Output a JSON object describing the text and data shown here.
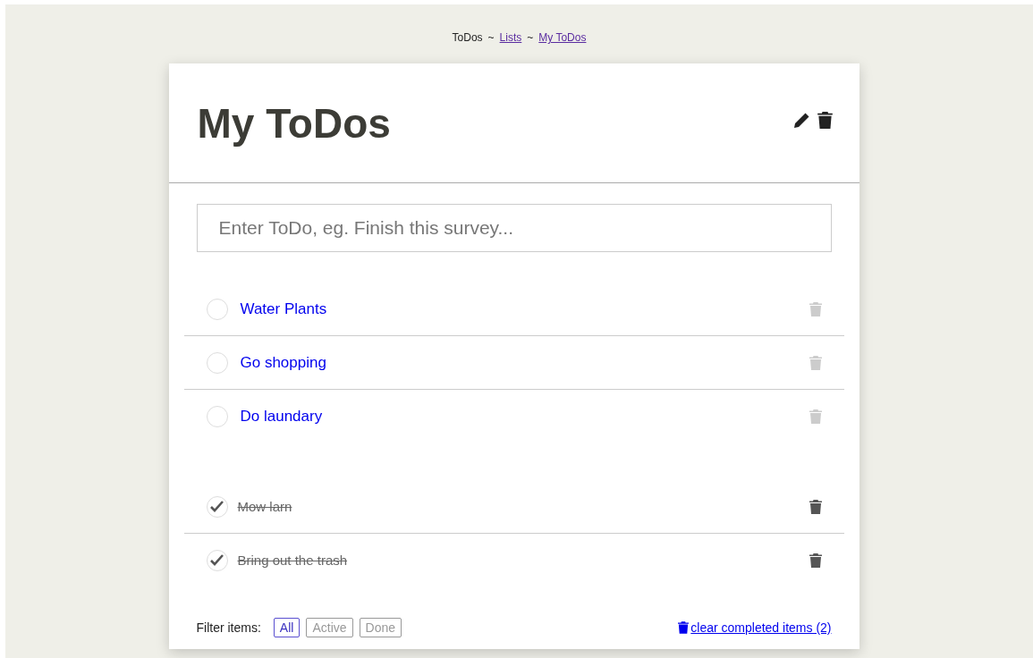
{
  "breadcrumb": [
    {
      "label": "ToDos",
      "link": false
    },
    {
      "label": "Lists",
      "link": true
    },
    {
      "label": "My ToDos",
      "link": true
    }
  ],
  "separator": "~",
  "title": "My ToDos",
  "input": {
    "placeholder": "Enter ToDo, eg. Finish this survey..."
  },
  "active_todos": [
    {
      "label": "Water Plants",
      "done": false
    },
    {
      "label": "Go shopping",
      "done": false
    },
    {
      "label": "Do laundary",
      "done": false
    }
  ],
  "done_todos": [
    {
      "label": "Mow larn",
      "done": true
    },
    {
      "label": "Bring out the trash",
      "done": true
    }
  ],
  "filter": {
    "label": "Filter items:",
    "options": [
      {
        "label": "All",
        "selected": true
      },
      {
        "label": "Active",
        "selected": false
      },
      {
        "label": "Done",
        "selected": false
      }
    ]
  },
  "clear_link": "clear completed items (2)"
}
